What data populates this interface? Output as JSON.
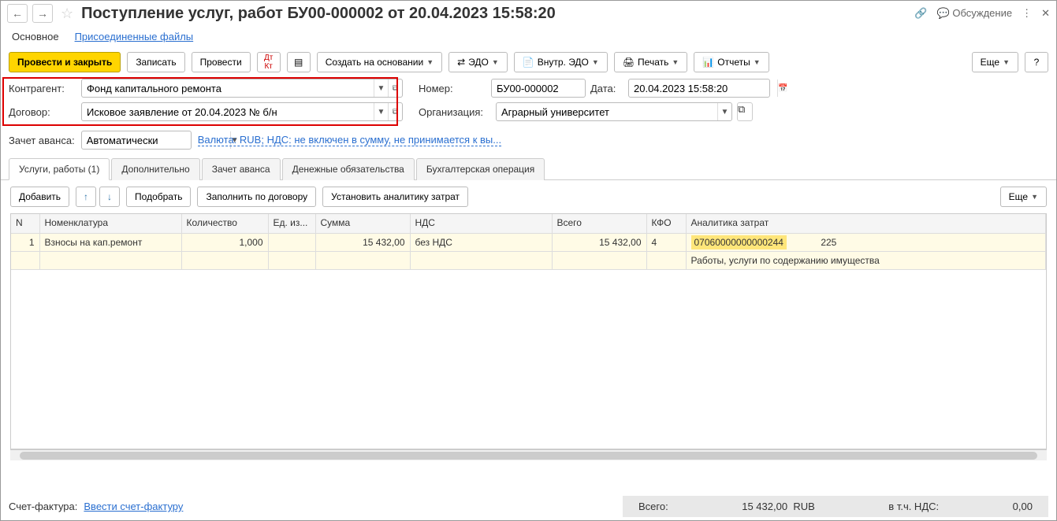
{
  "title": "Поступление услуг, работ БУ00-000002 от 20.04.2023 15:58:20",
  "sections": {
    "main": "Основное",
    "files": "Присоединенные файлы"
  },
  "toolbar": {
    "save_close": "Провести и закрыть",
    "write": "Записать",
    "post": "Провести",
    "create_based": "Создать на основании",
    "edo": "ЭДО",
    "int_edo": "Внутр. ЭДО",
    "print": "Печать",
    "reports": "Отчеты",
    "more": "Еще",
    "help": "?",
    "discuss": "Обсуждение"
  },
  "form": {
    "contractor_label": "Контрагент:",
    "contractor": "Фонд капитального ремонта",
    "contract_label": "Договор:",
    "contract": "Исковое заявление от 20.04.2023 № б/н",
    "number_label": "Номер:",
    "number": "БУ00-000002",
    "date_label": "Дата:",
    "date": "20.04.2023 15:58:20",
    "org_label": "Организация:",
    "org": "Аграрный университет",
    "advance_label": "Зачет аванса:",
    "advance": "Автоматически",
    "currency_link": "Валюта: RUB; НДС: не включен в сумму, не принимается к вы..."
  },
  "tabs": {
    "t1": "Услуги, работы (1)",
    "t2": "Дополнительно",
    "t3": "Зачет аванса",
    "t4": "Денежные обязательства",
    "t5": "Бухгалтерская операция"
  },
  "tab_toolbar": {
    "add": "Добавить",
    "pick": "Подобрать",
    "fill": "Заполнить по договору",
    "analytics": "Установить аналитику затрат",
    "more": "Еще"
  },
  "cols": {
    "n": "N",
    "nom": "Номенклатура",
    "qty": "Количество",
    "unit": "Ед. из...",
    "sum": "Сумма",
    "vat": "НДС",
    "total": "Всего",
    "kfo": "КФО",
    "analytics": "Аналитика затрат"
  },
  "row": {
    "n": "1",
    "nom": "Взносы на кап.ремонт",
    "qty": "1,000",
    "unit": "",
    "sum": "15 432,00",
    "vat": "без НДС",
    "total": "15 432,00",
    "kfo": "4",
    "an_code": "07060000000000244",
    "an_ext": "225",
    "an_desc": "Работы, услуги по содержанию имущества"
  },
  "footer": {
    "sf_label": "Счет-фактура:",
    "sf_link": "Ввести счет-фактуру",
    "total_label": "Всего:",
    "total": "15 432,00",
    "cur": "RUB",
    "vat_label": "в т.ч. НДС:",
    "vat": "0,00"
  }
}
